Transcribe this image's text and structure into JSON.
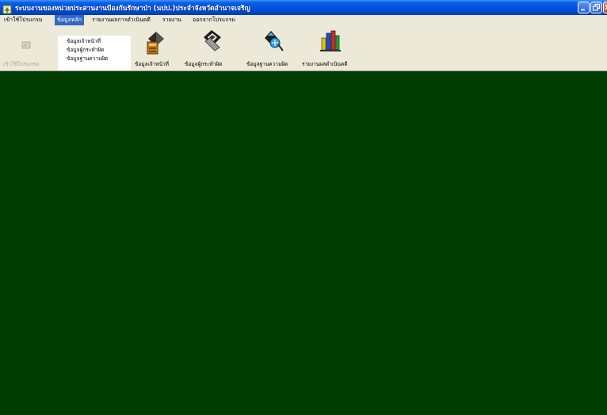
{
  "window": {
    "title": "ระบบงานของหน่วยประสานงานป้องกันรักษาป่า (นปป.)ประจำจังหวัดอำนาจเจริญ",
    "icon": "app-icon",
    "controls": [
      "minimize-icon",
      "restore-icon",
      "close-icon"
    ]
  },
  "menubar": {
    "items": [
      {
        "label": "เข้าใช้โปรแกรม"
      },
      {
        "label": "ข้อมูลหลัก",
        "active": true
      },
      {
        "label": "รายงานผลการดำเนินคดี"
      },
      {
        "label": "รายงาน"
      },
      {
        "label": "ออกจากโปรแกรม"
      }
    ]
  },
  "dropdown": {
    "items": [
      {
        "label": "ข้อมูลเจ้าหน้าที่"
      },
      {
        "label": "ข้อมูลผู้กระทำผิด"
      },
      {
        "label": "ข้อมูลฐานความผิด"
      }
    ]
  },
  "toolbar": {
    "buttons": [
      {
        "label": "เข้าใช้โปรแกรม",
        "icon": "login-icon",
        "disabled": true
      },
      {
        "label": "ข้อมูลเจ้าหน้าที่",
        "icon": "officer-icon"
      },
      {
        "label": "ข้อมูลผู้กระทำผิด",
        "icon": "offender-icon"
      },
      {
        "label": "ข้อมูลฐานความผิด",
        "icon": "database-icon"
      },
      {
        "label": "รายงานผลดำเนินคดี",
        "icon": "results-chart-icon"
      }
    ]
  },
  "colors": {
    "titlebar": "#0054e3",
    "menu_highlight": "#316ac5",
    "workspace": "#003d00",
    "chrome": "#ece9d8"
  }
}
